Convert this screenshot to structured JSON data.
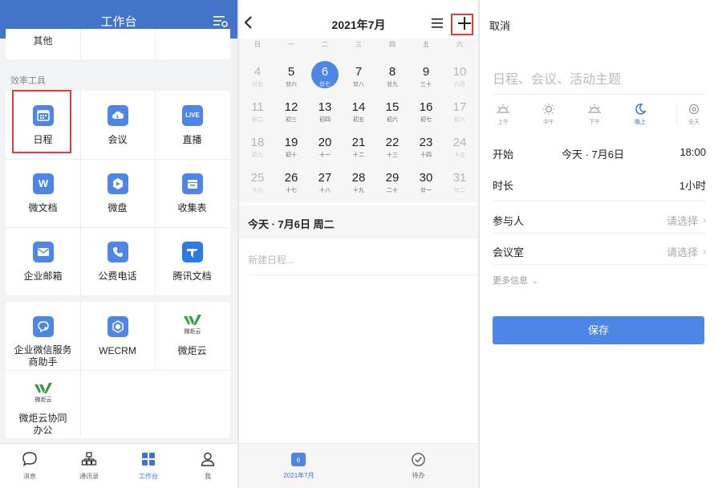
{
  "workbench": {
    "title": "工作台",
    "top_partial_label": "其他",
    "section_label": "效率工具",
    "tiles": [
      {
        "label": "日程",
        "icon": "calendar-icon"
      },
      {
        "label": "会议",
        "icon": "cloud-meeting-icon"
      },
      {
        "label": "直播",
        "icon": "live-icon",
        "badge": "LIVE"
      },
      {
        "label": "微文档",
        "icon": "doc-w-icon",
        "badge": "W"
      },
      {
        "label": "微盘",
        "icon": "drive-icon"
      },
      {
        "label": "收集表",
        "icon": "form-icon"
      },
      {
        "label": "企业邮箱",
        "icon": "mail-icon"
      },
      {
        "label": "公费电话",
        "icon": "phone-icon"
      },
      {
        "label": "腾讯文档",
        "icon": "tencent-docs-icon"
      }
    ],
    "tiles2": [
      {
        "label": "企业微信服务商助手",
        "icon": "service-chat-icon"
      },
      {
        "label": "WECRM",
        "icon": "wecrm-icon"
      },
      {
        "label": "微炬云",
        "icon": "weijuyun-logo-icon",
        "logo_text": "微炬云"
      },
      {
        "label": "微炬云协同办公",
        "icon": "weijuyun-logo-icon",
        "logo_text": "微炬云"
      }
    ],
    "tabbar": [
      {
        "label": "消息",
        "icon": "message-icon"
      },
      {
        "label": "通讯录",
        "icon": "contacts-icon"
      },
      {
        "label": "工作台",
        "icon": "workbench-icon",
        "active": true
      },
      {
        "label": "我",
        "icon": "profile-icon"
      }
    ]
  },
  "calendar": {
    "title": "2021年7月",
    "weekdays": [
      "日",
      "一",
      "二",
      "三",
      "四",
      "五",
      "六"
    ],
    "days": [
      {
        "n": "4",
        "l": "廿五",
        "muted": true
      },
      {
        "n": "5",
        "l": "廿六"
      },
      {
        "n": "6",
        "l": "廿七",
        "selected": true
      },
      {
        "n": "7",
        "l": "廿八"
      },
      {
        "n": "8",
        "l": "廿九"
      },
      {
        "n": "9",
        "l": "三十"
      },
      {
        "n": "10",
        "l": "六月",
        "muted": true
      },
      {
        "n": "11",
        "l": "初二",
        "muted": true
      },
      {
        "n": "12",
        "l": "初三"
      },
      {
        "n": "13",
        "l": "初四"
      },
      {
        "n": "14",
        "l": "初五"
      },
      {
        "n": "15",
        "l": "初六"
      },
      {
        "n": "16",
        "l": "初七"
      },
      {
        "n": "17",
        "l": "初八",
        "muted": true
      },
      {
        "n": "18",
        "l": "初九",
        "muted": true
      },
      {
        "n": "19",
        "l": "初十"
      },
      {
        "n": "20",
        "l": "十一"
      },
      {
        "n": "21",
        "l": "十二"
      },
      {
        "n": "22",
        "l": "十三"
      },
      {
        "n": "23",
        "l": "十四"
      },
      {
        "n": "24",
        "l": "十五",
        "muted": true
      },
      {
        "n": "25",
        "l": "十六",
        "muted": true
      },
      {
        "n": "26",
        "l": "十七"
      },
      {
        "n": "27",
        "l": "十八"
      },
      {
        "n": "28",
        "l": "十九"
      },
      {
        "n": "29",
        "l": "二十"
      },
      {
        "n": "30",
        "l": "廿一"
      },
      {
        "n": "31",
        "l": "廿二",
        "muted": true
      }
    ],
    "today_label": "今天 · 7月6日 周二",
    "new_event_placeholder": "新建日程...",
    "bottom": [
      {
        "label": "2021年7月",
        "badge": "6",
        "active": true
      },
      {
        "label": "待办"
      }
    ]
  },
  "event_form": {
    "cancel_label": "取消",
    "subject_placeholder": "日程、会议、活动主题",
    "times_of_day": [
      {
        "label": "上午",
        "icon": "sunrise-icon"
      },
      {
        "label": "中午",
        "icon": "sun-icon"
      },
      {
        "label": "下午",
        "icon": "sunset-icon"
      },
      {
        "label": "晚上",
        "icon": "moon-icon",
        "active": true
      },
      {
        "label": "全天",
        "icon": "allday-icon"
      }
    ],
    "start_label": "开始",
    "start_date": "今天 · 7月6日",
    "start_time": "18:00",
    "duration_label": "时长",
    "duration_value": "1小时",
    "attendees_label": "参与人",
    "attendees_value": "请选择",
    "room_label": "会议室",
    "room_value": "请选择",
    "more_label": "更多信息",
    "save_label": "保存"
  },
  "colors": {
    "accent": "#4d86e6",
    "header": "#4474c8",
    "highlight": "#e23a35"
  }
}
